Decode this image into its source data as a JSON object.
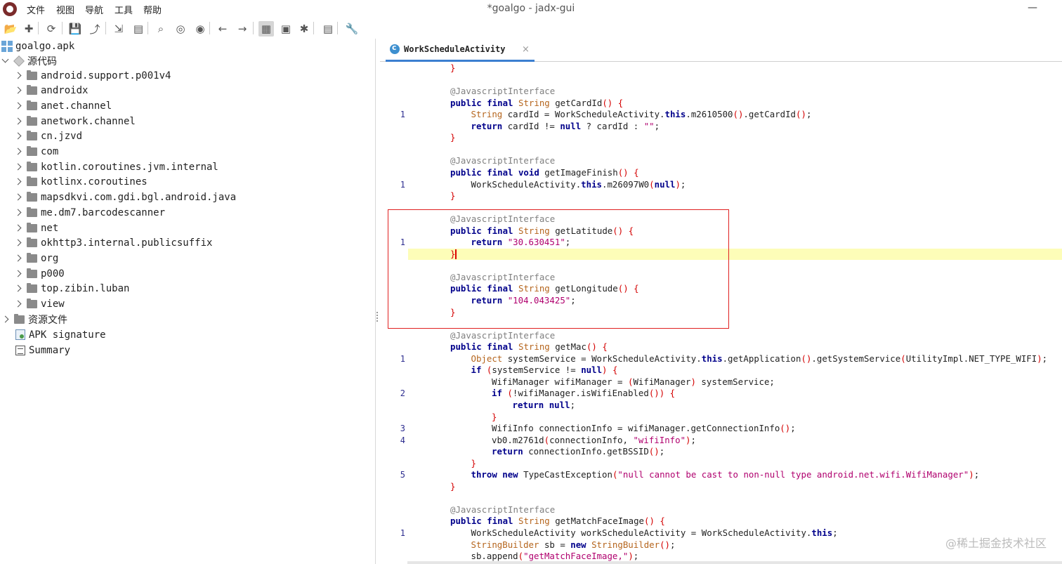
{
  "window": {
    "title": "*goalgo - jadx-gui",
    "minimize": "—"
  },
  "menu": [
    "文件",
    "视图",
    "导航",
    "工具",
    "帮助"
  ],
  "toolbar": [
    {
      "icon": "open-folder-icon",
      "glyph": "📂"
    },
    {
      "icon": "add-files-icon",
      "glyph": "✚"
    },
    {
      "icon": "sync-icon",
      "glyph": "⟳"
    },
    {
      "icon": "save-icon",
      "glyph": "💾"
    },
    {
      "icon": "export-icon",
      "glyph": "⤴"
    },
    {
      "icon": "expand-icon",
      "glyph": "⇲"
    },
    {
      "icon": "tree-icon",
      "glyph": "▤"
    },
    {
      "icon": "search-icon",
      "glyph": "⌕"
    },
    {
      "icon": "find-usage-icon",
      "glyph": "◎"
    },
    {
      "icon": "find-class-icon",
      "glyph": "◉"
    },
    {
      "icon": "back-icon",
      "glyph": "←"
    },
    {
      "icon": "forward-icon",
      "glyph": "→"
    },
    {
      "icon": "decompile-icon",
      "glyph": "▦"
    },
    {
      "icon": "quick-tabs-icon",
      "glyph": "▣"
    },
    {
      "icon": "debug-icon",
      "glyph": "✱"
    },
    {
      "icon": "log-icon",
      "glyph": "▤"
    },
    {
      "icon": "preferences-icon",
      "glyph": "🔧"
    }
  ],
  "tree": {
    "root": "goalgo.apk",
    "source": "源代码",
    "packages": [
      "android.support.p001v4",
      "androidx",
      "anet.channel",
      "anetwork.channel",
      "cn.jzvd",
      "com",
      "kotlin.coroutines.jvm.internal",
      "kotlinx.coroutines",
      "mapsdkvi.com.gdi.bgl.android.java",
      "me.dm7.barcodescanner",
      "net",
      "okhttp3.internal.publicsuffix",
      "org",
      "p000",
      "top.zibin.luban",
      "view"
    ],
    "resources": "资源文件",
    "apk_signature": "APK signature",
    "summary": "Summary"
  },
  "editor": {
    "tab": "WorkScheduleActivity",
    "tab_close": "×",
    "lines": [
      {
        "n": "",
        "ind": 0,
        "t": [
          [
            "}",
            "pu"
          ]
        ]
      },
      {
        "n": "",
        "ind": 0,
        "t": []
      },
      {
        "n": "",
        "ind": 0,
        "t": [
          [
            "@JavascriptInterface",
            "an"
          ]
        ]
      },
      {
        "n": "",
        "ind": 0,
        "t": [
          [
            "public final ",
            "kw"
          ],
          [
            "String ",
            "ty"
          ],
          [
            "getCardId",
            "nm"
          ],
          [
            "() {",
            "pu"
          ]
        ]
      },
      {
        "n": "1",
        "ind": 1,
        "t": [
          [
            "String ",
            "ty"
          ],
          [
            "cardId = WorkScheduleActivity.",
            "nm"
          ],
          [
            "this",
            "kw"
          ],
          [
            ".m2610500",
            "nm"
          ],
          [
            "()",
            "pu"
          ],
          [
            ".getCardId",
            "nm"
          ],
          [
            "()",
            "pu"
          ],
          [
            ";",
            "nm"
          ]
        ]
      },
      {
        "n": "",
        "ind": 1,
        "t": [
          [
            "return ",
            "kw"
          ],
          [
            "cardId != ",
            "nm"
          ],
          [
            "null",
            "kw"
          ],
          [
            " ? cardId : ",
            "nm"
          ],
          [
            "\"\"",
            "st"
          ],
          [
            ";",
            "nm"
          ]
        ]
      },
      {
        "n": "",
        "ind": 0,
        "t": [
          [
            "}",
            "pu"
          ]
        ]
      },
      {
        "n": "",
        "ind": 0,
        "t": []
      },
      {
        "n": "",
        "ind": 0,
        "t": [
          [
            "@JavascriptInterface",
            "an"
          ]
        ]
      },
      {
        "n": "",
        "ind": 0,
        "t": [
          [
            "public final void ",
            "kw"
          ],
          [
            "getImageFinish",
            "nm"
          ],
          [
            "() {",
            "pu"
          ]
        ]
      },
      {
        "n": "1",
        "ind": 1,
        "t": [
          [
            "WorkScheduleActivity.",
            "nm"
          ],
          [
            "this",
            "kw"
          ],
          [
            ".m26097W0",
            "nm"
          ],
          [
            "(",
            "pu"
          ],
          [
            "null",
            "kw"
          ],
          [
            ")",
            "pu"
          ],
          [
            ";",
            "nm"
          ]
        ]
      },
      {
        "n": "",
        "ind": 0,
        "t": [
          [
            "}",
            "pu"
          ]
        ]
      },
      {
        "n": "",
        "ind": 0,
        "t": []
      },
      {
        "n": "",
        "ind": 0,
        "t": [
          [
            "@JavascriptInterface",
            "an"
          ]
        ]
      },
      {
        "n": "",
        "ind": 0,
        "t": [
          [
            "public final ",
            "kw"
          ],
          [
            "String ",
            "ty"
          ],
          [
            "getLatitude",
            "nm"
          ],
          [
            "() {",
            "pu"
          ]
        ]
      },
      {
        "n": "1",
        "ind": 1,
        "t": [
          [
            "return ",
            "kw"
          ],
          [
            "\"30.630451\"",
            "st"
          ],
          [
            ";",
            "nm"
          ]
        ]
      },
      {
        "n": "",
        "ind": 0,
        "hl": true,
        "caret": true,
        "t": [
          [
            "}",
            "pu"
          ]
        ]
      },
      {
        "n": "",
        "ind": 0,
        "t": []
      },
      {
        "n": "",
        "ind": 0,
        "t": [
          [
            "@JavascriptInterface",
            "an"
          ]
        ]
      },
      {
        "n": "",
        "ind": 0,
        "t": [
          [
            "public final ",
            "kw"
          ],
          [
            "String ",
            "ty"
          ],
          [
            "getLongitude",
            "nm"
          ],
          [
            "() {",
            "pu"
          ]
        ]
      },
      {
        "n": "",
        "ind": 1,
        "t": [
          [
            "return ",
            "kw"
          ],
          [
            "\"104.043425\"",
            "st"
          ],
          [
            ";",
            "nm"
          ]
        ]
      },
      {
        "n": "",
        "ind": 0,
        "t": [
          [
            "}",
            "pu"
          ]
        ]
      },
      {
        "n": "",
        "ind": 0,
        "t": []
      },
      {
        "n": "",
        "ind": 0,
        "t": [
          [
            "@JavascriptInterface",
            "an"
          ]
        ]
      },
      {
        "n": "",
        "ind": 0,
        "t": [
          [
            "public final ",
            "kw"
          ],
          [
            "String ",
            "ty"
          ],
          [
            "getMac",
            "nm"
          ],
          [
            "() {",
            "pu"
          ]
        ]
      },
      {
        "n": "1",
        "ind": 1,
        "t": [
          [
            "Object ",
            "ty"
          ],
          [
            "systemService = WorkScheduleActivity.",
            "nm"
          ],
          [
            "this",
            "kw"
          ],
          [
            ".getApplication",
            "nm"
          ],
          [
            "()",
            "pu"
          ],
          [
            ".getSystemService",
            "nm"
          ],
          [
            "(",
            "pu"
          ],
          [
            "UtilityImpl.NET_TYPE_WIFI",
            "nm"
          ],
          [
            ")",
            "pu"
          ],
          [
            ";",
            "nm"
          ]
        ]
      },
      {
        "n": "",
        "ind": 1,
        "t": [
          [
            "if ",
            "kw"
          ],
          [
            "(",
            "pu"
          ],
          [
            "systemService != ",
            "nm"
          ],
          [
            "null",
            "kw"
          ],
          [
            ") {",
            "pu"
          ]
        ]
      },
      {
        "n": "",
        "ind": 2,
        "t": [
          [
            "WifiManager wifiManager = ",
            "nm"
          ],
          [
            "(",
            "pu"
          ],
          [
            "WifiManager",
            "nm"
          ],
          [
            ")",
            "pu"
          ],
          [
            " systemService;",
            "nm"
          ]
        ]
      },
      {
        "n": "2",
        "ind": 2,
        "t": [
          [
            "if ",
            "kw"
          ],
          [
            "(",
            "pu"
          ],
          [
            "!wifiManager.isWifiEnabled",
            "nm"
          ],
          [
            "()) {",
            "pu"
          ]
        ]
      },
      {
        "n": "",
        "ind": 3,
        "t": [
          [
            "return null",
            "kw"
          ],
          [
            ";",
            "nm"
          ]
        ]
      },
      {
        "n": "",
        "ind": 2,
        "t": [
          [
            "}",
            "pu"
          ]
        ]
      },
      {
        "n": "3",
        "ind": 2,
        "t": [
          [
            "WifiInfo connectionInfo = wifiManager.getConnectionInfo",
            "nm"
          ],
          [
            "()",
            "pu"
          ],
          [
            ";",
            "nm"
          ]
        ]
      },
      {
        "n": "4",
        "ind": 2,
        "t": [
          [
            "vb0.m2761d",
            "nm"
          ],
          [
            "(",
            "pu"
          ],
          [
            "connectionInfo, ",
            "nm"
          ],
          [
            "\"wifiInfo\"",
            "st"
          ],
          [
            ")",
            "pu"
          ],
          [
            ";",
            "nm"
          ]
        ]
      },
      {
        "n": "",
        "ind": 2,
        "t": [
          [
            "return ",
            "kw"
          ],
          [
            "connectionInfo.getBSSID",
            "nm"
          ],
          [
            "()",
            "pu"
          ],
          [
            ";",
            "nm"
          ]
        ]
      },
      {
        "n": "",
        "ind": 1,
        "t": [
          [
            "}",
            "pu"
          ]
        ]
      },
      {
        "n": "5",
        "ind": 1,
        "t": [
          [
            "throw new ",
            "kw"
          ],
          [
            "TypeCastException",
            "nm"
          ],
          [
            "(",
            "pu"
          ],
          [
            "\"null cannot be cast to non-null type android.net.wifi.WifiManager\"",
            "st"
          ],
          [
            ")",
            "pu"
          ],
          [
            ";",
            "nm"
          ]
        ]
      },
      {
        "n": "",
        "ind": 0,
        "t": [
          [
            "}",
            "pu"
          ]
        ]
      },
      {
        "n": "",
        "ind": 0,
        "t": []
      },
      {
        "n": "",
        "ind": 0,
        "t": [
          [
            "@JavascriptInterface",
            "an"
          ]
        ]
      },
      {
        "n": "",
        "ind": 0,
        "t": [
          [
            "public final ",
            "kw"
          ],
          [
            "String ",
            "ty"
          ],
          [
            "getMatchFaceImage",
            "nm"
          ],
          [
            "() {",
            "pu"
          ]
        ]
      },
      {
        "n": "1",
        "ind": 1,
        "t": [
          [
            "WorkScheduleActivity workScheduleActivity = WorkScheduleActivity.",
            "nm"
          ],
          [
            "this",
            "kw"
          ],
          [
            ";",
            "nm"
          ]
        ]
      },
      {
        "n": "",
        "ind": 1,
        "t": [
          [
            "StringBuilder ",
            "ty"
          ],
          [
            "sb = ",
            "nm"
          ],
          [
            "new ",
            "kw"
          ],
          [
            "StringBuilder",
            "ty"
          ],
          [
            "()",
            "pu"
          ],
          [
            ";",
            "nm"
          ]
        ]
      },
      {
        "n": "",
        "ind": 1,
        "t": [
          [
            "sb.append",
            "nm"
          ],
          [
            "(",
            "pu"
          ],
          [
            "\"getMatchFaceImage,\"",
            "st"
          ],
          [
            ")",
            "pu"
          ],
          [
            ";",
            "nm"
          ]
        ]
      }
    ]
  },
  "watermark": "@稀土掘金技术社区"
}
